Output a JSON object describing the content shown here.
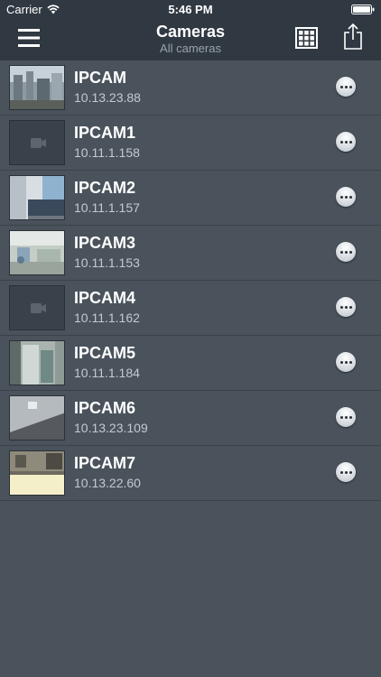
{
  "status_bar": {
    "carrier": "Carrier",
    "time": "5:46 PM"
  },
  "nav": {
    "title": "Cameras",
    "subtitle": "All cameras",
    "icons": [
      "menu-icon",
      "grid-view-icon",
      "share-icon"
    ]
  },
  "cameras": [
    {
      "name": "IPCAM",
      "ip": "10.13.23.88",
      "thumb": "outdoor-city"
    },
    {
      "name": "IPCAM1",
      "ip": "10.11.1.158",
      "thumb": "placeholder"
    },
    {
      "name": "IPCAM2",
      "ip": "10.11.1.157",
      "thumb": "office-corridor"
    },
    {
      "name": "IPCAM3",
      "ip": "10.11.1.153",
      "thumb": "lobby"
    },
    {
      "name": "IPCAM4",
      "ip": "10.11.1.162",
      "thumb": "placeholder"
    },
    {
      "name": "IPCAM5",
      "ip": "10.11.1.184",
      "thumb": "hallway-door"
    },
    {
      "name": "IPCAM6",
      "ip": "10.13.23.109",
      "thumb": "ceiling"
    },
    {
      "name": "IPCAM7",
      "ip": "10.13.22.60",
      "thumb": "street-bright"
    }
  ]
}
